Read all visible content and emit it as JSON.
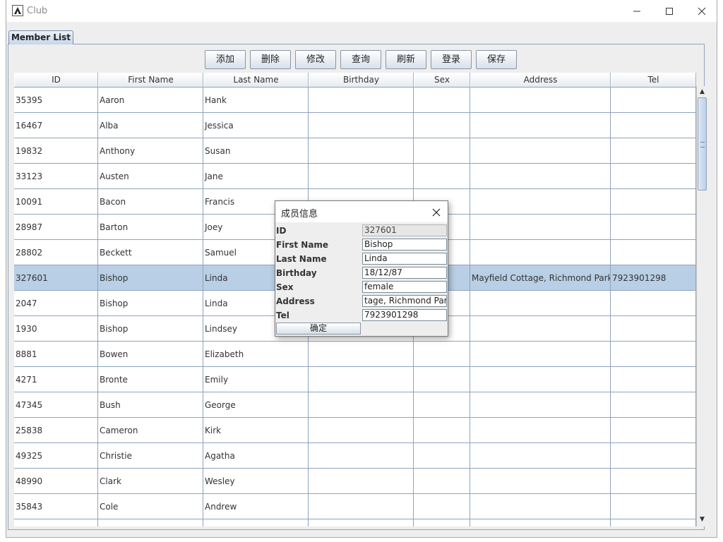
{
  "window": {
    "title": "Club",
    "minimize": "—",
    "maximize": "☐",
    "close": "✕"
  },
  "tab": {
    "label": "Member List"
  },
  "toolbar": [
    "添加",
    "删除",
    "修改",
    "查询",
    "刷新",
    "登录",
    "保存"
  ],
  "table": {
    "columns": [
      "ID",
      "First Name",
      "Last Name",
      "Birthday",
      "Sex",
      "Address",
      "Tel"
    ],
    "rows": [
      [
        "35395",
        "Aaron",
        "Hank",
        "",
        "",
        "",
        ""
      ],
      [
        "16467",
        "Alba",
        "Jessica",
        "",
        "",
        "",
        ""
      ],
      [
        "19832",
        "Anthony",
        "Susan",
        "",
        "",
        "",
        ""
      ],
      [
        "33123",
        "Austen",
        "Jane",
        "",
        "",
        "",
        ""
      ],
      [
        "10091",
        "Bacon",
        "Francis",
        "",
        "",
        "",
        ""
      ],
      [
        "28987",
        "Barton",
        "Joey",
        "",
        "",
        "",
        ""
      ],
      [
        "28802",
        "Beckett",
        "Samuel",
        "",
        "",
        "",
        ""
      ],
      [
        "327601",
        "Bishop",
        "Linda",
        "",
        "",
        "Mayfield Cottage, Richmond Park",
        "7923901298"
      ],
      [
        "2047",
        "Bishop",
        "Linda",
        "",
        "",
        "",
        ""
      ],
      [
        "1930",
        "Bishop",
        "Lindsey",
        "",
        "",
        "",
        ""
      ],
      [
        "8881",
        "Bowen",
        "Elizabeth",
        "",
        "",
        "",
        ""
      ],
      [
        "4271",
        "Bronte",
        "Emily",
        "",
        "",
        "",
        ""
      ],
      [
        "47345",
        "Bush",
        "George",
        "",
        "",
        "",
        ""
      ],
      [
        "25838",
        "Cameron",
        "Kirk",
        "",
        "",
        "",
        ""
      ],
      [
        "49325",
        "Christie",
        "Agatha",
        "",
        "",
        "",
        ""
      ],
      [
        "48990",
        "Clark",
        "Wesley",
        "",
        "",
        "",
        ""
      ],
      [
        "35843",
        "Cole",
        "Andrew",
        "",
        "",
        "",
        ""
      ],
      [
        "",
        "",
        "",
        "",
        "",
        "",
        ""
      ]
    ],
    "selected_row": 7
  },
  "dialog": {
    "title": "成员信息",
    "close": "✕",
    "fields": [
      {
        "label": "ID",
        "value": "327601",
        "readonly": true
      },
      {
        "label": "First Name",
        "value": "Bishop"
      },
      {
        "label": "Last Name",
        "value": "Linda"
      },
      {
        "label": "Birthday",
        "value": "18/12/87"
      },
      {
        "label": "Sex",
        "value": "female"
      },
      {
        "label": "Address",
        "value": "tage, Richmond Park"
      },
      {
        "label": "Tel",
        "value": "7923901298"
      }
    ],
    "ok_label": "确定"
  },
  "scrollbar": {
    "up": "▲",
    "down": "▼"
  }
}
